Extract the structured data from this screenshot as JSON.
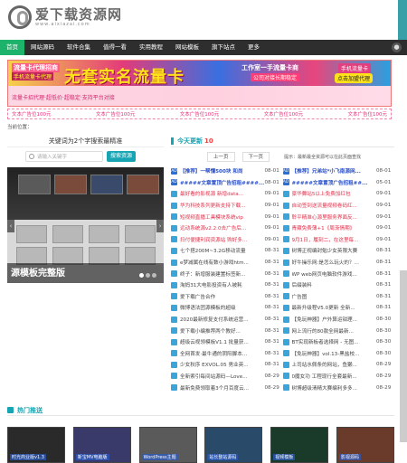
{
  "site": {
    "logo_text": "爱下载资源网",
    "logo_sub": "www.aixiazai.com"
  },
  "colors": {
    "nav_bg": "#2e2e2e",
    "nav_active": "#1db36a",
    "accent": "#17a4b3",
    "date_icon": "#3ba4d9"
  },
  "nav": {
    "items": [
      "首页",
      "网站源码",
      "软件合集",
      "值得一看",
      "实用教程",
      "网站模板",
      "旗下站点",
      "更多"
    ],
    "user_icon": "user-icon"
  },
  "banner": {
    "left_title": "流量卡代理招商",
    "left_sub": "手机流量卡代理",
    "main_text": "无套实名流量卡",
    "right_title": "工作室一手流量卡商",
    "right_sub": "公司对接长期稳定",
    "tag_a": "手机流量卡",
    "tag_b": "点击加盟代理",
    "foot": "流量卡招代理·超低价·超稳定·支持平台对接"
  },
  "ads": [
    "文本广告位100元",
    "文本广告位100元",
    "文本广告位100元",
    "文本广告位100元",
    "文本广告位100元"
  ],
  "breadcrumb": "当前位置：",
  "search": {
    "title": "关键词为2个字搜索最精准",
    "placeholder": "请输入关键字",
    "button": "搜索资源"
  },
  "slider": {
    "caption": "源模板完整版"
  },
  "news": {
    "title": "今天更新",
    "count": "10",
    "prev": "上一页",
    "next": "下一页",
    "hint": "提示：最新最全资源可以在此页面查找",
    "left": [
      {
        "t": "【推荐】一帮懂500块 和尚",
        "d": "08-01",
        "style": "blue",
        "icon": "AD"
      },
      {
        "t": "#####文章置顶广告招租####...",
        "d": "08-01",
        "style": "blue",
        "icon": "AD"
      },
      {
        "t": "最好看的影视源 新增data...",
        "d": "09-01",
        "style": "red",
        "icon": ""
      },
      {
        "t": "华为科技系列更新支持下载...",
        "d": "09-01",
        "style": "red",
        "icon": ""
      },
      {
        "t": "短视频直播工具模块系统vip",
        "d": "09-01",
        "style": "red",
        "icon": ""
      },
      {
        "t": "远动系统源v2.2.0去广告后...",
        "d": "09-01",
        "style": "red",
        "icon": ""
      },
      {
        "t": "扫付便捷利润资源站 购好多...",
        "d": "09-01",
        "style": "red",
        "icon": ""
      },
      {
        "t": "七个搭200M~3.2G移动流量",
        "d": "08-31",
        "style": "",
        "icon": ""
      },
      {
        "t": "e梦减属在线有数小游戏htm...",
        "d": "08-31",
        "style": "",
        "icon": ""
      },
      {
        "t": "终子：新增服装建置标签新...",
        "d": "08-31",
        "style": "",
        "icon": ""
      },
      {
        "t": "淘妈31大电影投资有人被耗",
        "d": "08-31",
        "style": "",
        "icon": ""
      },
      {
        "t": "爱下载广告合作",
        "d": "08-31",
        "style": "",
        "icon": ""
      },
      {
        "t": "微博语法团源模板的超级",
        "d": "08-31",
        "style": "",
        "icon": ""
      },
      {
        "t": "2020最新修复支付系统运营...",
        "d": "08-31",
        "style": "",
        "icon": ""
      },
      {
        "t": "爱下载小编推荐两个教好...",
        "d": "08-31",
        "style": "",
        "icon": ""
      },
      {
        "t": "超级云视领模板V1.1 批量获...",
        "d": "08-31",
        "style": "",
        "icon": ""
      },
      {
        "t": "全网首发·最牛通的阴阳脚本...",
        "d": "08-31",
        "style": "",
        "icon": ""
      },
      {
        "t": "少女秋序 EXVOL.05 男业英...",
        "d": "08-31",
        "style": "",
        "icon": ""
      },
      {
        "t": "全新索引每间站源码—Love...",
        "d": "08-29",
        "style": "",
        "icon": ""
      },
      {
        "t": "最新免费领取着3个月百度云...",
        "d": "08-29",
        "style": "",
        "icon": ""
      }
    ],
    "right": [
      {
        "t": "【推荐】兄弟站*小飞南源网...",
        "d": "08-01",
        "style": "blue",
        "icon": "AD"
      },
      {
        "t": "#####文章置顶广告招租##...",
        "d": "05-01",
        "style": "blue",
        "icon": "AD"
      },
      {
        "t": "豪华舞站5以上免费加红包",
        "d": "09-01",
        "style": "red",
        "icon": ""
      },
      {
        "t": "自动签到送流量视频卷码红...",
        "d": "09-01",
        "style": "red",
        "icon": ""
      },
      {
        "t": "聆平精准心源里服务界面反...",
        "d": "09-01",
        "style": "red",
        "icon": ""
      },
      {
        "t": "青藏免费薄+1《周渐情期》",
        "d": "09-01",
        "style": "red",
        "icon": ""
      },
      {
        "t": "9月1日，履刻二，在这里每...",
        "d": "09-01",
        "style": "red",
        "icon": ""
      },
      {
        "t": "树博正视编封勉少女英限大赛",
        "d": "08-31",
        "style": "",
        "icon": ""
      },
      {
        "t": "好牛操乐网:是怎么玩火的？...",
        "d": "08-31",
        "style": "",
        "icon": ""
      },
      {
        "t": "WP web网页电脑软件游戏...",
        "d": "08-31",
        "style": "",
        "icon": ""
      },
      {
        "t": "后缀装料",
        "d": "08-31",
        "style": "",
        "icon": ""
      },
      {
        "t": "广告图",
        "d": "08-31",
        "style": "",
        "icon": ""
      },
      {
        "t": "最新升级程V5.0更新 全新...",
        "d": "08-31",
        "style": "",
        "icon": ""
      },
      {
        "t": "【免玩神器】户外算运钳理...",
        "d": "08-30",
        "style": "",
        "icon": ""
      },
      {
        "t": "网上流行的80款全网最新...",
        "d": "08-30",
        "style": "",
        "icon": ""
      },
      {
        "t": "BT实现新板者选择网 - 无图...",
        "d": "08-30",
        "style": "",
        "icon": ""
      },
      {
        "t": "【免玩神器】vol.13-黑盐校...",
        "d": "08-30",
        "style": "",
        "icon": ""
      },
      {
        "t": "上司站水佩条的网站，鱼獭...",
        "d": "08-29",
        "style": "",
        "icon": ""
      },
      {
        "t": "0魔女功 工程现行全套最新...",
        "d": "08-29",
        "style": "",
        "icon": ""
      },
      {
        "t": "树博超级清精大赛编利多多...",
        "d": "08-29",
        "style": "",
        "icon": ""
      }
    ]
  },
  "hot": {
    "title": "热门推送",
    "items": [
      "时光商业版v1.3",
      "新宝MV电脑版",
      "WordPress主题",
      "站长整站源码",
      "视频模板",
      "影视源码"
    ]
  }
}
